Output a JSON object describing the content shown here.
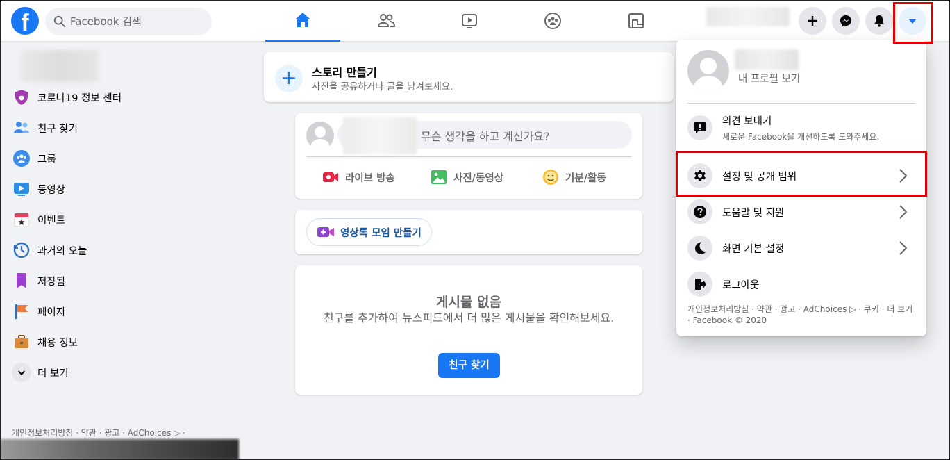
{
  "header": {
    "logo": "f",
    "search_placeholder": "Facebook 검색",
    "nav_tabs": [
      "home-icon",
      "friends-icon",
      "watch-icon",
      "groups-icon",
      "gaming-icon"
    ],
    "active_tab": "home"
  },
  "sidebar": {
    "items": [
      {
        "label": "코로나19 정보 센터",
        "icon": "covid-shield-icon"
      },
      {
        "label": "친구 찾기",
        "icon": "friends-icon"
      },
      {
        "label": "그룹",
        "icon": "groups-icon"
      },
      {
        "label": "동영상",
        "icon": "video-icon"
      },
      {
        "label": "이벤트",
        "icon": "event-calendar-icon"
      },
      {
        "label": "과거의 오늘",
        "icon": "memories-clock-icon"
      },
      {
        "label": "저장됨",
        "icon": "saved-bookmark-icon"
      },
      {
        "label": "페이지",
        "icon": "pages-flag-icon"
      },
      {
        "label": "채용 정보",
        "icon": "jobs-briefcase-icon"
      },
      {
        "label": "더 보기",
        "icon": "chevron-down-icon"
      }
    ],
    "footer": "개인정보처리방침 · 약관 · 광고 · AdChoices ▷ ·"
  },
  "feed": {
    "story": {
      "title": "스토리 만들기",
      "subtitle": "사진을 공유하거나 글을 남겨보세요."
    },
    "composer": {
      "placeholder": "무슨 생각을 하고 계신가요?",
      "actions": [
        "라이브 방송",
        "사진/동영상",
        "기분/활동"
      ]
    },
    "room_button": "영상톡 모임 만들기",
    "no_posts": {
      "title": "게시물 없음",
      "subtitle": "친구를 추가하여 뉴스피드에서 더 많은 게시물을 확인해보세요.",
      "button": "친구 찾기"
    }
  },
  "menu": {
    "profile_sub": "내 프로필 보기",
    "feedback": {
      "label": "의견 보내기",
      "sub": "새로운 Facebook을 개선하도록 도와주세요."
    },
    "items": [
      {
        "label": "설정 및 공개 범위",
        "icon": "gear-icon"
      },
      {
        "label": "도움말 및 지원",
        "icon": "help-question-icon"
      },
      {
        "label": "화면 기본 설정",
        "icon": "moon-icon"
      },
      {
        "label": "로그아웃",
        "icon": "logout-door-icon"
      }
    ],
    "footer": "개인정보처리방침 · 약관 · 광고 · AdChoices ▷ · 쿠키 · 더 보기 · Facebook © 2020"
  },
  "colors": {
    "brand": "#1877f2",
    "highlight": "#e00000",
    "background": "#f0f2f5"
  }
}
